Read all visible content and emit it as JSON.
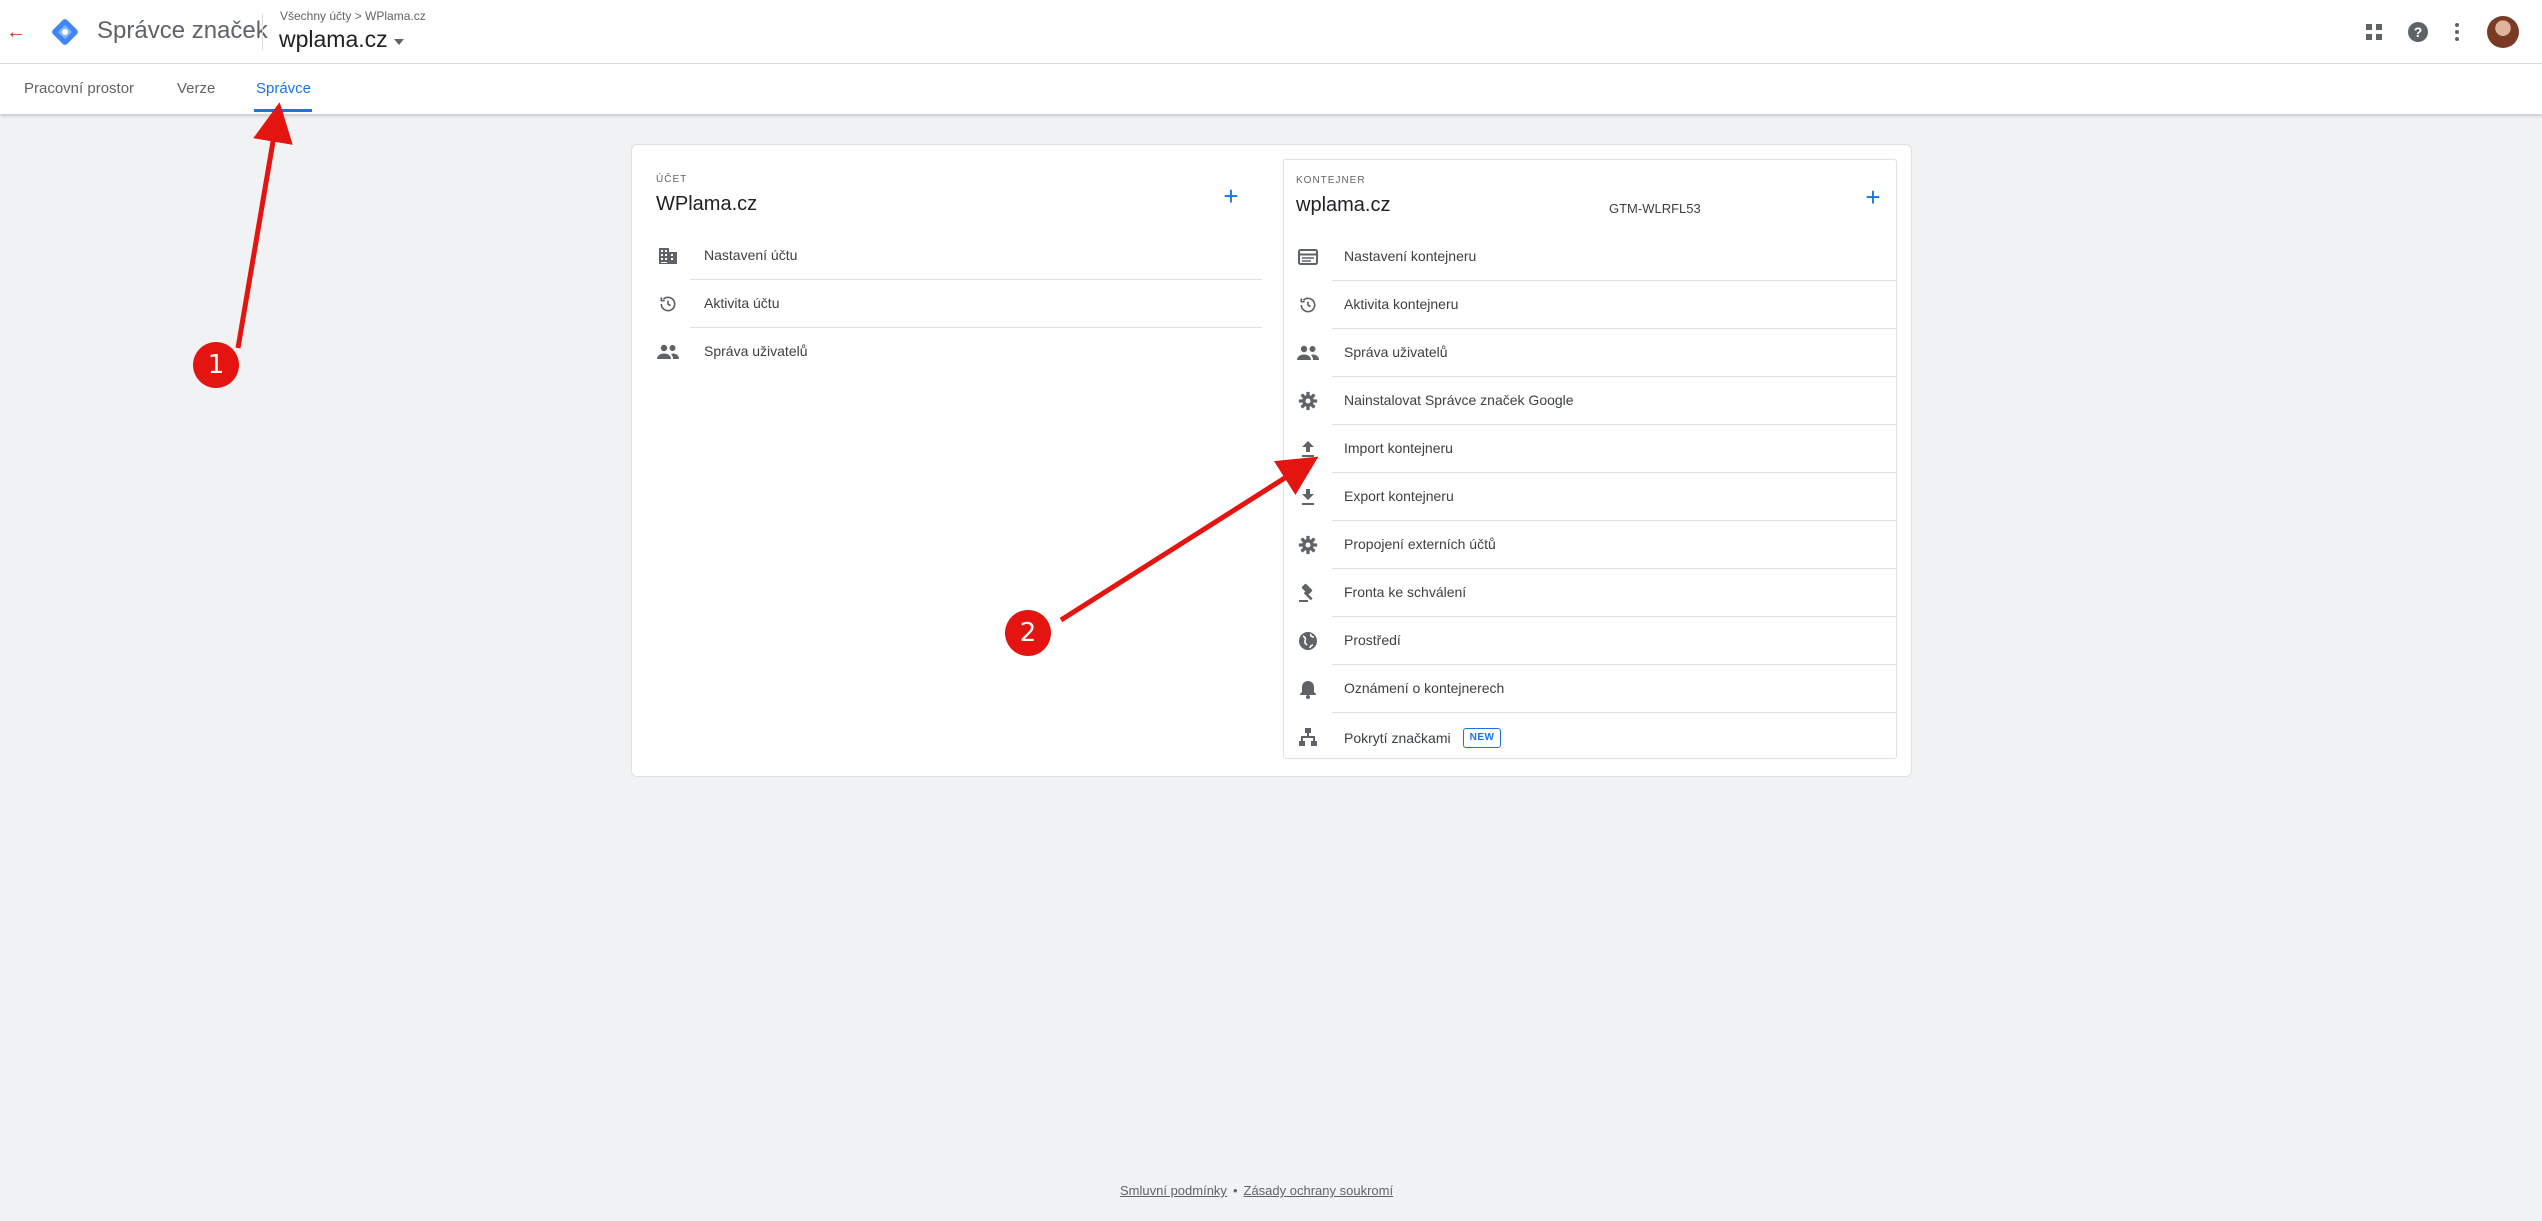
{
  "header": {
    "back_label": "←",
    "app_title": "Správce značek",
    "breadcrumb": "Všechny účty > WPlama.cz",
    "container_name": "wplama.cz",
    "accent": "#1a73e8"
  },
  "tabs": [
    {
      "label": "Pracovní prostor",
      "active": false
    },
    {
      "label": "Verze",
      "active": false
    },
    {
      "label": "Správce",
      "active": true
    }
  ],
  "account": {
    "section_label": "ÚČET",
    "name": "WPlama.cz",
    "add_label": "+",
    "items": [
      {
        "label": "Nastavení účtu",
        "icon": "building-icon"
      },
      {
        "label": "Aktivita účtu",
        "icon": "history-icon"
      },
      {
        "label": "Správa uživatelů",
        "icon": "people-icon"
      }
    ]
  },
  "container": {
    "section_label": "KONTEJNER",
    "name": "wplama.cz",
    "id": "GTM-WLRFL53",
    "add_label": "+",
    "items": [
      {
        "label": "Nastavení kontejneru",
        "icon": "window-icon"
      },
      {
        "label": "Aktivita kontejneru",
        "icon": "history-icon"
      },
      {
        "label": "Správa uživatelů",
        "icon": "people-icon"
      },
      {
        "label": "Nainstalovat Správce značek Google",
        "icon": "gear-icon"
      },
      {
        "label": "Import kontejneru",
        "icon": "upload-icon"
      },
      {
        "label": "Export kontejneru",
        "icon": "download-icon"
      },
      {
        "label": "Propojení externích účtů",
        "icon": "gear-icon"
      },
      {
        "label": "Fronta ke schválení",
        "icon": "gavel-icon"
      },
      {
        "label": "Prostředí",
        "icon": "globe-icon"
      },
      {
        "label": "Oznámení o kontejnerech",
        "icon": "bell-icon"
      },
      {
        "label": "Pokrytí značkami",
        "icon": "sitemap-icon",
        "badge": "NEW"
      }
    ]
  },
  "footer": {
    "terms": "Smluvní podmínky",
    "separator": "•",
    "privacy": "Zásady ochrany soukromí"
  },
  "annotations": {
    "marker_1": "1",
    "marker_2": "2",
    "color": "#e41410"
  }
}
